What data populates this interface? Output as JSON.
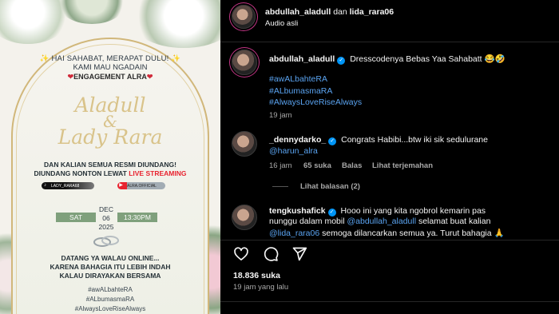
{
  "poster": {
    "greeting": "✨ HAI SAHABAT, MERAPAT DULU! ✨",
    "greeting2": "KAMI MAU NGADAIN",
    "event": "ENGAGEMENT ALRA",
    "name1": "Aladull",
    "amp": "&",
    "name2": "Lady Rara",
    "invite": "DAN KALIAN SEMUA RESMI DIUNDANG!",
    "watch_prefix": "DIUNDANG NONTON LEWAT ",
    "watch_live": "LIVE STREAMING",
    "tiktok_handle": "LADY_RARA68",
    "youtube_handle": "ALRA.OFFICIAL",
    "day": "SAT",
    "month": "DEC",
    "date": "06",
    "year": "2025",
    "time": "13:30PM",
    "come": "DATANG YA WALAU ONLINE...",
    "because": "KARENA BAHAGIA ITU LEBIH INDAH",
    "celebrate": "KALAU DIRAYAKAN BERSAMA",
    "hashtags": [
      "#awALbahteRA",
      "#ALbumasmaRA",
      "#AlwaysLoveRiseAlways"
    ]
  },
  "header": {
    "user1": "abdullah_aladull",
    "joiner": " dan ",
    "user2": "lida_rara06",
    "audio": "Audio asli"
  },
  "comments": [
    {
      "username": "abdullah_aladull",
      "text": "Dresscodenya Bebas Yaa Sahabatt 😂🤣",
      "tags": [
        "#awALbahteRA",
        "#ALbumasmaRA",
        "#AlwaysLoveRiseAlways"
      ],
      "time": "19 jam"
    },
    {
      "username": "_dennydarko_",
      "text": "Congrats Habibi...btw iki sik sedulurane",
      "mention": "@harun_alra",
      "time": "16 jam",
      "likes": "65 suka",
      "reply": "Balas",
      "translate": "Lihat terjemahan",
      "view_replies": "Lihat balasan (2)"
    },
    {
      "username": "tengkushafick",
      "text1": "Hooo ini yang kita ngobrol kemarin pas",
      "text2a": "nunggu dalam mobil ",
      "mention1": "@abdullah_aladull",
      "text2b": " selamat buat kalian",
      "mention2": "@lida_rara06",
      "text3": " semoga dilancarkan semua ya. Turut bahagia 🙏"
    }
  ],
  "footer": {
    "likes": "18.836 suka",
    "time": "19 jam yang lalu"
  },
  "colors": {
    "gold": "#d9c38a",
    "verified": "#0095f6",
    "live": "#e8232f",
    "date_box": "#7fa07c"
  },
  "icons": [
    "heart-icon",
    "comment-icon",
    "share-icon",
    "verified-icon",
    "tiktok-icon",
    "youtube-icon",
    "rings-icon"
  ]
}
